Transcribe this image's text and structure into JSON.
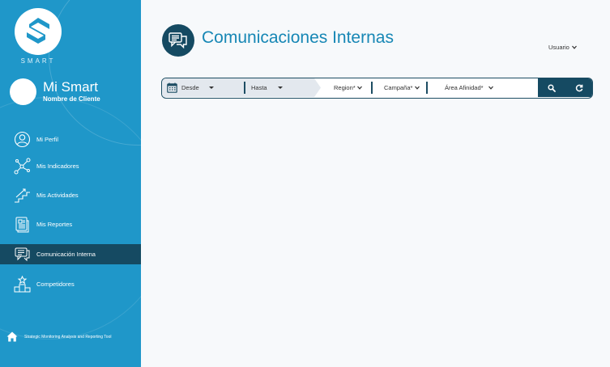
{
  "sidebar": {
    "logo_text": "SMART",
    "brand_name": "Mi Smart",
    "client_name": "Nombre de Cliente",
    "items": [
      {
        "label": "Mi Perfil",
        "icon": "user-icon"
      },
      {
        "label": "Mis Indicadores",
        "icon": "network-icon"
      },
      {
        "label": "Mis Actividades",
        "icon": "stairs-chart-icon"
      },
      {
        "label": "Mis Reportes",
        "icon": "report-icon"
      },
      {
        "label": "Comunicación Interna",
        "icon": "chat-icon",
        "active": true
      },
      {
        "label": "Competidores",
        "icon": "podium-icon"
      }
    ],
    "footer_text": "Strategic Monitoring Analysis and Reporting Tool"
  },
  "header": {
    "title": "Comunicaciones Internas",
    "user_menu": "Usuario"
  },
  "filters": {
    "desde": "Desde",
    "hasta": "Hasta",
    "region": "Region*",
    "campana": "Campaña*",
    "area": "Área Afinidad*"
  },
  "colors": {
    "sidebar": "#1f97c9",
    "active": "#154a62",
    "title": "#1787b5",
    "background": "#f7f9fb"
  }
}
